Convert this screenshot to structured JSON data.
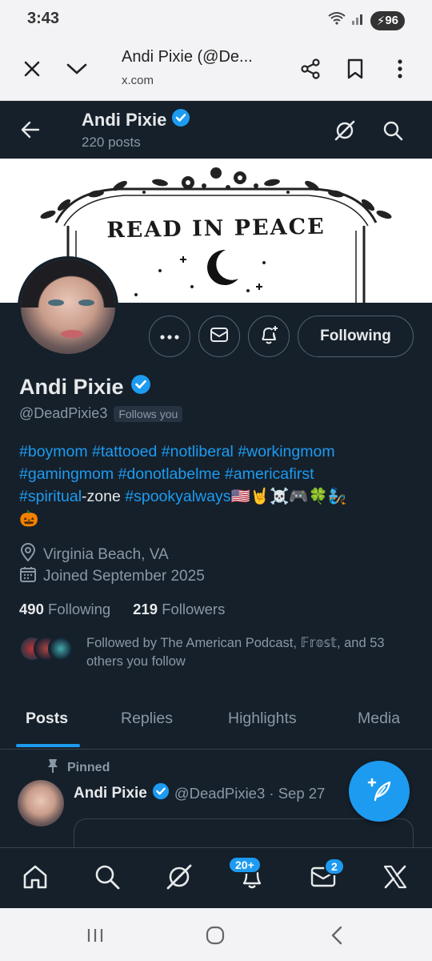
{
  "status_bar": {
    "time": "3:43",
    "battery": "96"
  },
  "browser": {
    "title": "Andi Pixie (@De...",
    "url": "x.com"
  },
  "header": {
    "name": "Andi Pixie",
    "posts_count": "220 posts"
  },
  "banner": {
    "text": "READ IN PEACE"
  },
  "actions": {
    "following_label": "Following"
  },
  "profile": {
    "name": "Andi Pixie",
    "handle": "@DeadPixie3",
    "follows_you": "Follows you",
    "bio": {
      "line1": [
        "#boymom",
        "#tattooed",
        "#notliberal",
        "#workingmom"
      ],
      "line2": [
        "#gamingmom",
        "#donotlabelme",
        "#americafirst"
      ],
      "line3_tag1": "#spiritual",
      "line3_text": "-zone ",
      "line3_tag2": "#spookyalways",
      "emojis": "🇺🇸🤘☠️🎮🍀🧞",
      "line4": "🎃"
    },
    "location": "Virginia Beach, VA",
    "joined": "Joined September 2025",
    "following_count": "490",
    "following_label": "Following",
    "followers_count": "219",
    "followers_label": "Followers",
    "followed_by": "Followed by The American Podcast, 𝔽𝕣𝕠𝕤𝕥, and 53 others you follow"
  },
  "tabs": [
    "Posts",
    "Replies",
    "Highlights",
    "Media"
  ],
  "pinned_post": {
    "pinned_label": "Pinned",
    "name": "Andi Pixie",
    "handle_date": "@DeadPixie3 · Sep 27"
  },
  "bottom_nav": {
    "notifications_badge": "20+",
    "messages_badge": "2"
  },
  "colors": {
    "background": "#15202b",
    "accent": "#1d9bf0",
    "muted": "#8b98a5",
    "text": "#e7e9ea"
  }
}
